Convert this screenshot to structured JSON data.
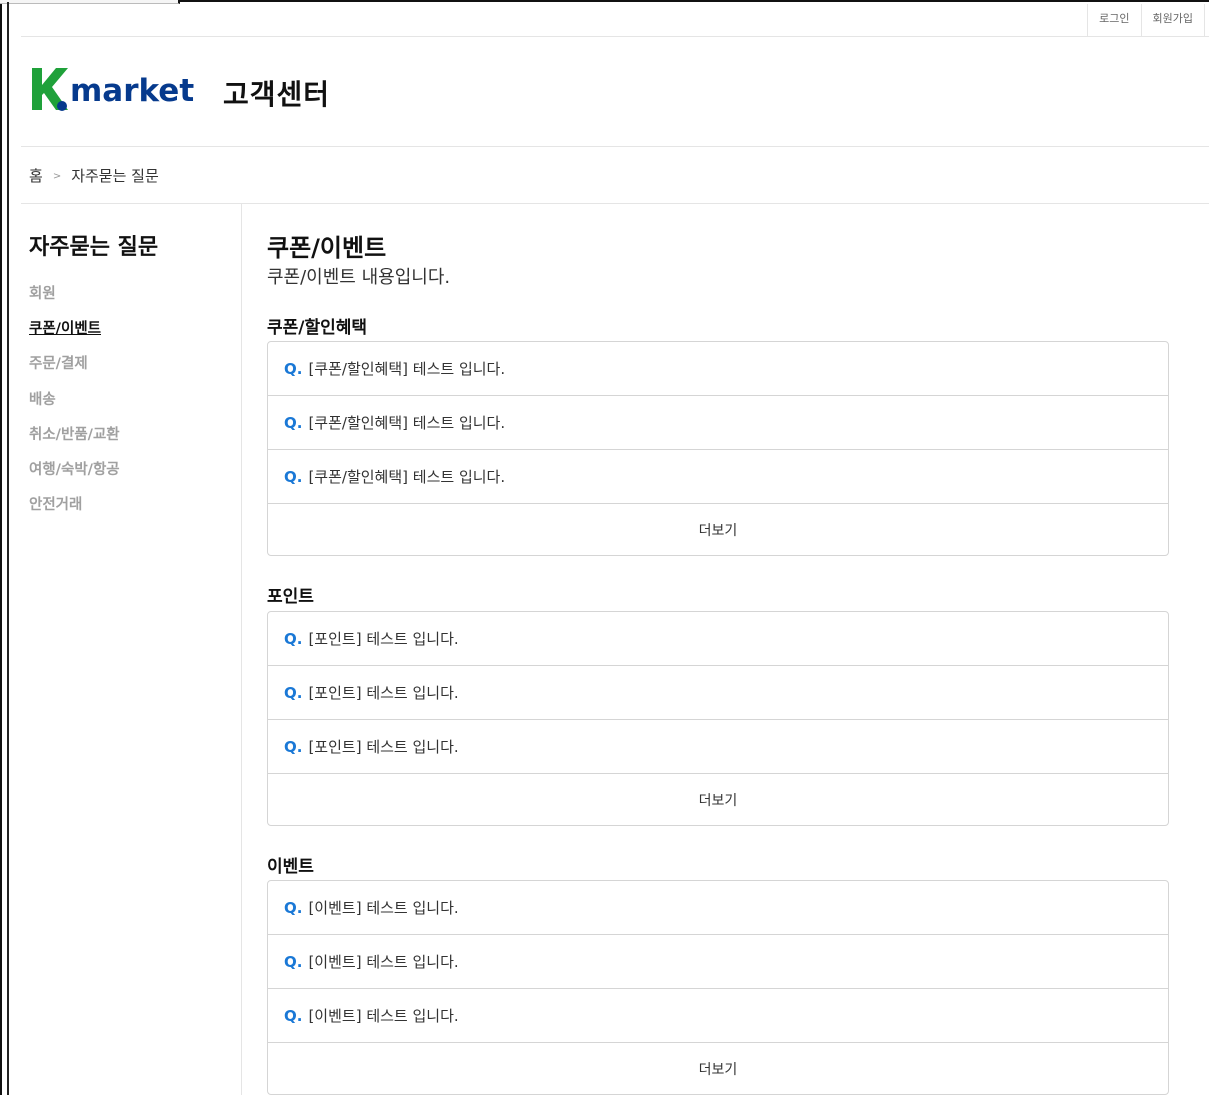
{
  "util": {
    "login": "로그인",
    "signup": "회원가입"
  },
  "header": {
    "logo_text": "market",
    "title": "고객센터",
    "colors": {
      "logo_k": "#1fa13a",
      "logo_text": "#063a8d",
      "logo_dot": "#063a8d"
    }
  },
  "breadcrumb": {
    "home": "홈",
    "separator": ">",
    "current": "자주묻는 질문"
  },
  "sidebar": {
    "title": "자주묻는 질문",
    "items": [
      {
        "label": "회원",
        "active": false
      },
      {
        "label": "쿠폰/이벤트",
        "active": true
      },
      {
        "label": "주문/결제",
        "active": false
      },
      {
        "label": "배송",
        "active": false
      },
      {
        "label": "취소/반품/교환",
        "active": false
      },
      {
        "label": "여행/숙박/항공",
        "active": false
      },
      {
        "label": "안전거래",
        "active": false
      }
    ]
  },
  "content": {
    "title": "쿠폰/이벤트",
    "description": "쿠폰/이벤트 내용입니다.",
    "q_marker": "Q.",
    "more_label": "더보기",
    "sections": [
      {
        "title": "쿠폰/할인혜택",
        "items": [
          "[쿠폰/할인혜택] 테스트 입니다.",
          "[쿠폰/할인혜택] 테스트 입니다.",
          "[쿠폰/할인혜택] 테스트 입니다."
        ]
      },
      {
        "title": "포인트",
        "items": [
          "[포인트] 테스트 입니다.",
          "[포인트] 테스트 입니다.",
          "[포인트] 테스트 입니다."
        ]
      },
      {
        "title": "이벤트",
        "items": [
          "[이벤트] 테스트 입니다.",
          "[이벤트] 테스트 입니다.",
          "[이벤트] 테스트 입니다."
        ]
      }
    ]
  }
}
